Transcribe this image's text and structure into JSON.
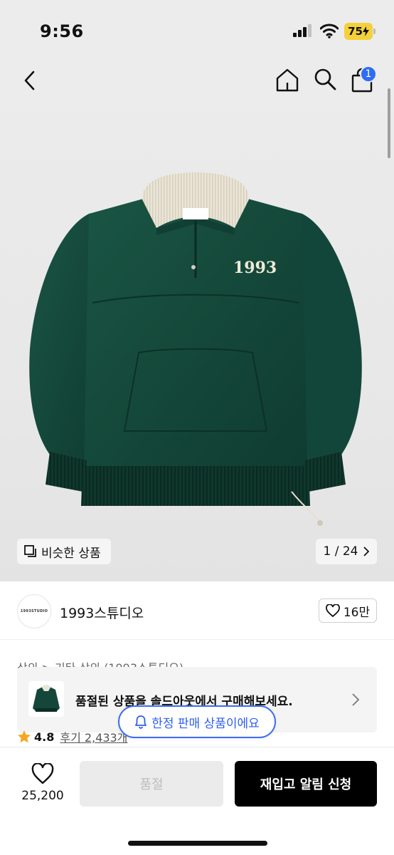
{
  "status_bar": {
    "time": "9:56",
    "battery": "75"
  },
  "nav": {
    "cart_count": "1"
  },
  "gallery": {
    "similar_label": "비슷한 상품",
    "pager": "1 / 24",
    "image_logo_text": "1993"
  },
  "brand": {
    "logo_text": "1993STUDIO",
    "name": "1993스튜디오",
    "likes": "16만"
  },
  "breadcrumb": "상의 > 기타 상의 (1993스튜디오)",
  "banner": {
    "text": "품절된 상품을 솔드아웃에서 구매해보세요."
  },
  "limited_notice": "한정 판매 상품이에요",
  "rating": {
    "value": "4.8",
    "reviews": "후기 2,433개"
  },
  "bottom_bar": {
    "wish_count": "25,200",
    "soldout_label": "품절",
    "restock_label": "재입고 알림 신청"
  },
  "colors": {
    "accent_blue": "#2e6cf6",
    "star": "#f5a623",
    "garment_green": "#14473a",
    "battery_yellow": "#f4d13a"
  }
}
